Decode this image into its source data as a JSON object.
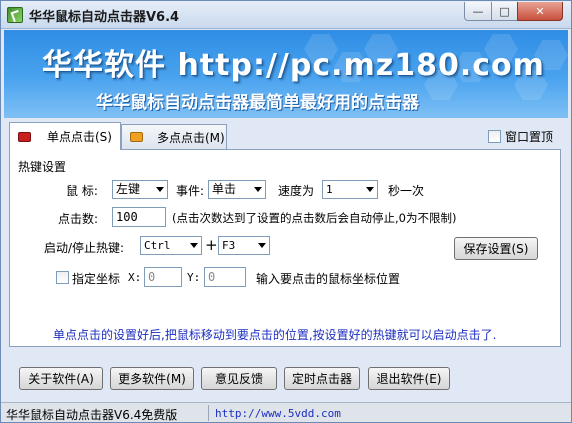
{
  "window": {
    "title": "华华鼠标自动点击器V6.4",
    "min_glyph": "—",
    "max_glyph": "□",
    "close_glyph": "✕"
  },
  "banner": {
    "title": "华华软件 http://pc.mz180.com",
    "subtitle": "华华鼠标自动点击器最简单最好用的点击器"
  },
  "tabs": [
    {
      "label": "单点点击(S)",
      "icon": "red-square-icon",
      "active": true
    },
    {
      "label": "多点点击(M)",
      "icon": "orange-square-icon",
      "active": false
    }
  ],
  "topmost": {
    "label": "窗口置顶",
    "checked": false
  },
  "hotkey_settings": {
    "group_label": "热键设置",
    "mouse_label": "鼠 标:",
    "mouse_value": "左键",
    "event_label": "事件:",
    "event_value": "单击",
    "speed_label": "速度为",
    "speed_value": "1",
    "speed_unit": "秒一次",
    "click_count_label": "点击数:",
    "click_count_value": "100",
    "click_count_hint": "(点击次数达到了设置的点击数后会自动停止,0为不限制)",
    "start_stop_label": "启动/停止热键:",
    "hotkey_mod": "Ctrl",
    "plus": "+",
    "hotkey_key": "F3",
    "save_button": "保存设置(S)",
    "fixed_coord_label": "指定坐标",
    "fixed_coord_checked": false,
    "x_label": "X:",
    "x_value": "0",
    "y_label": "Y:",
    "y_value": "0",
    "coord_hint": "输入要点击的鼠标坐标位置",
    "bottom_hint": "单点点击的设置好后,把鼠标移动到要点击的位置,按设置好的热键就可以启动点击了."
  },
  "buttons": {
    "about": "关于软件(A)",
    "more": "更多软件(M)",
    "feedback": "意见反馈",
    "timer": "定时点击器",
    "exit": "退出软件(E)"
  },
  "status": {
    "left": "华华鼠标自动点击器V6.4免费版",
    "link": "http://www.5vdd.com"
  },
  "colors": {
    "banner": "#2f8de4",
    "hint": "#1c2fc0",
    "close": "#c8503c"
  }
}
